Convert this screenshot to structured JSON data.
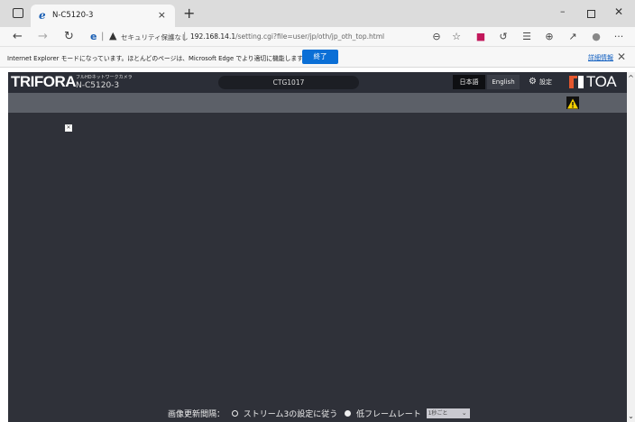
{
  "browser": {
    "tab_title": "N-C5120-3",
    "tab_close": "×",
    "new_tab": "+",
    "min": "–",
    "close": "✕",
    "security_text": "セキュリティ保護なし",
    "url_host": "192.168.14.1",
    "url_path": "/setting.cgi?file=user/jp/oth/jp_oth_top.html",
    "iebar_message": "Internet Explorer モードになっています。ほとんどのページは、Microsoft Edge でより適切に機能します。",
    "iebar_button": "終了",
    "iebar_link": "詳細情報",
    "iebar_close": "✕"
  },
  "app": {
    "brand": "TRIFORA",
    "subtitle": "フルHDネットワークカメラ",
    "model": "N-C5120-3",
    "camera_name": "CTG1017",
    "lang_ja": "日本語",
    "lang_en": "English",
    "settings_label": "設定",
    "logo_text": "TOA"
  },
  "footer": {
    "label": "画像更新間隔：",
    "option1": "ストリーム3の設定に従う",
    "option2": "低フレームレート",
    "select_value": "1秒ごと"
  },
  "colors": {
    "header_bg": "#2b2e37",
    "subbar_bg": "#5c6068",
    "main_bg": "#2f3139",
    "accent_blue": "#0b6fd6",
    "alert_yellow": "#f5d000"
  }
}
